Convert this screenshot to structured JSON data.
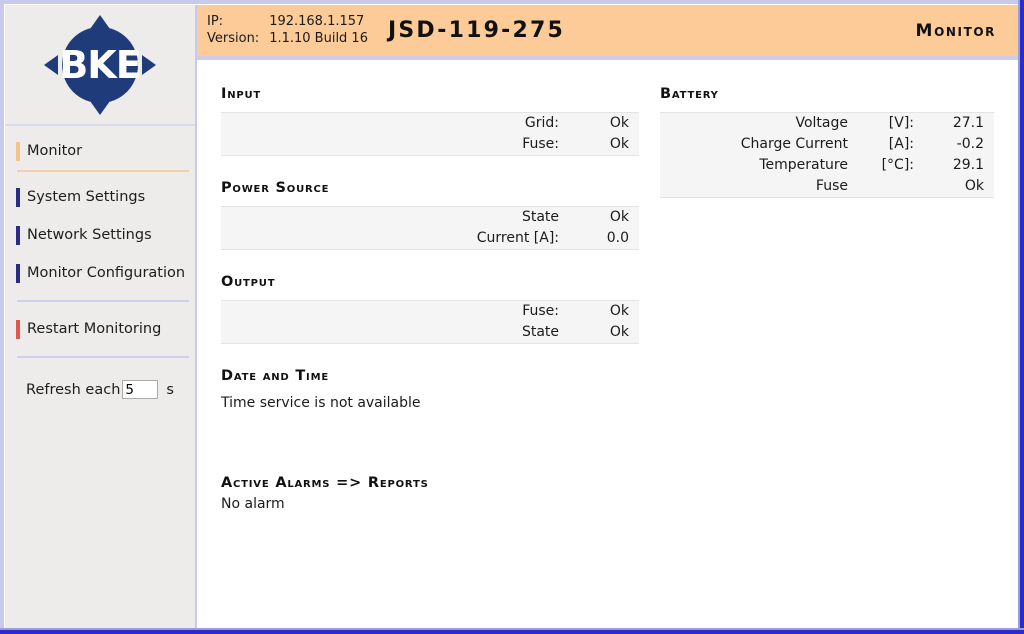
{
  "window": {
    "frame_color": "#2b2bcd",
    "frame_light_color": "#c9c9ea"
  },
  "sidebar": {
    "logo": {
      "text": "BKE",
      "icon": "bke-compass-logo",
      "color": "#1f3b7a"
    },
    "nav_items": [
      {
        "label": "Monitor",
        "state": "active",
        "bar_color": "#f5c48e"
      },
      {
        "label": "System Settings",
        "state": "normal",
        "bar_color": "#2b2b86"
      },
      {
        "label": "Network Settings",
        "state": "normal",
        "bar_color": "#2b2b86"
      },
      {
        "label": "Monitor Configuration",
        "state": "normal",
        "bar_color": "#2b2b86"
      },
      {
        "label": "Restart Monitoring",
        "state": "danger",
        "bar_color": "#e2564f"
      }
    ],
    "refresh": {
      "label": "Refresh each",
      "value": "5",
      "unit": "s"
    }
  },
  "header": {
    "ip_label": "IP:",
    "ip_value": "192.168.1.157",
    "version_label": "Version:",
    "version_value": "1.1.10 Build 16",
    "device_title": "JSD-119-275",
    "mode": "Monitor",
    "background": "#fccb97"
  },
  "sections": {
    "input": {
      "title": "Input",
      "rows": [
        {
          "label": "Grid:",
          "value": "Ok"
        },
        {
          "label": "Fuse:",
          "value": "Ok"
        }
      ]
    },
    "power_source": {
      "title": "Power Source",
      "rows": [
        {
          "label": "State",
          "value": "Ok"
        },
        {
          "label": "Current [A]:",
          "value": "0.0"
        }
      ]
    },
    "output": {
      "title": "Output",
      "rows": [
        {
          "label": "Fuse:",
          "value": "Ok"
        },
        {
          "label": "State",
          "value": "Ok"
        }
      ]
    },
    "date_and_time": {
      "title": "Date and Time",
      "text": "Time service is not available"
    },
    "active_alarms": {
      "title": "Active Alarms => Reports",
      "text": "No alarm"
    },
    "battery": {
      "title": "Battery",
      "rows": [
        {
          "label": "Voltage",
          "unit": "[V]:",
          "value": "27.1"
        },
        {
          "label": "Charge Current",
          "unit": "[A]:",
          "value": "-0.2"
        },
        {
          "label": "Temperature",
          "unit": "[°C]:",
          "value": "29.1"
        },
        {
          "label": "Fuse",
          "unit": "",
          "value": "Ok"
        }
      ]
    }
  }
}
